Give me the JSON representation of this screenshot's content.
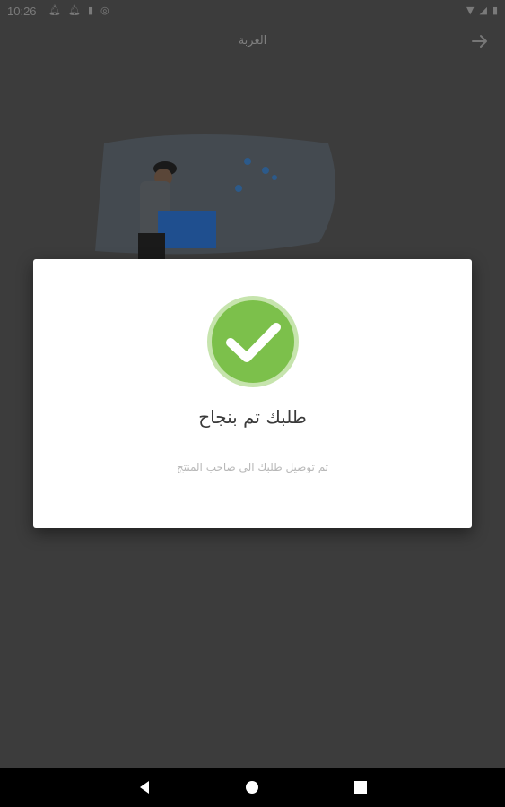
{
  "status_bar": {
    "time": "10:26"
  },
  "app_bar": {
    "title": "العربة"
  },
  "dialog": {
    "title": "طلبك تم بنجاح",
    "subtitle": "تم توصيل طلبك الي صاحب المنتج",
    "success_color": "#7cc04b"
  }
}
